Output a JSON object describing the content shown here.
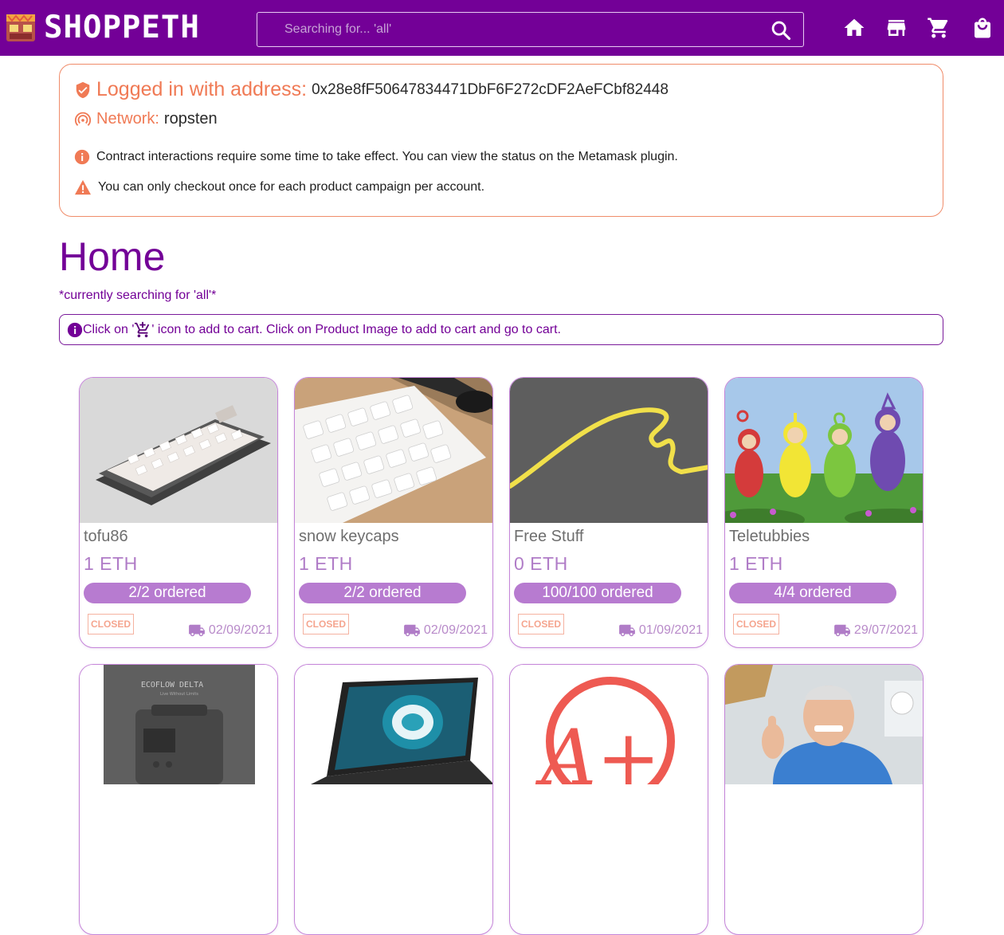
{
  "header": {
    "brand": "SHOPPETH",
    "search_placeholder": "Searching for... 'all'",
    "nav": [
      "home-icon",
      "store-icon",
      "cart-icon",
      "shopping-bag-icon"
    ]
  },
  "account": {
    "logged_label": "Logged in with address:",
    "address": "0x28e8fF50647834471DbF6F272cDF2AeFCbf82448",
    "network_label": "Network:",
    "network": "ropsten",
    "note_info": "Contract interactions require some time to take effect. You can view the status on the Metamask plugin.",
    "note_warning": "You can only checkout once for each product campaign per account."
  },
  "page": {
    "title": "Home",
    "search_note": "*currently searching for 'all'*",
    "hint_prefix": "Click on '",
    "hint_suffix": "' icon to add to cart. Click on Product Image to add to cart and go to cart."
  },
  "products": [
    {
      "name": "tofu86",
      "price": "1 ETH",
      "ordered": "2/2 ordered",
      "status": "CLOSED",
      "date": "02/09/2021",
      "image": "keyboard-photo"
    },
    {
      "name": "snow keycaps",
      "price": "1 ETH",
      "ordered": "2/2 ordered",
      "status": "CLOSED",
      "date": "02/09/2021",
      "image": "keycaps-photo"
    },
    {
      "name": "Free Stuff",
      "price": "0 ETH",
      "ordered": "100/100 ordered",
      "status": "CLOSED",
      "date": "01/09/2021",
      "image": "yellow-squiggle-image"
    },
    {
      "name": "Teletubbies",
      "price": "1 ETH",
      "ordered": "4/4 ordered",
      "status": "CLOSED",
      "date": "29/07/2021",
      "image": "teletubbies-photo"
    }
  ],
  "products_row2": [
    {
      "image": "ecoflow-delta-photo",
      "image_text": "ECOFLOW DELTA",
      "image_subtext": "Live Without Limits"
    },
    {
      "image": "laptop-photo"
    },
    {
      "image": "a-plus-image",
      "image_text": "A+"
    },
    {
      "image": "thumbs-up-man-photo"
    }
  ],
  "colors": {
    "brand": "#730097",
    "alert": "#f07a55",
    "card_border": "#c585d9",
    "progress": "#b77bd0"
  }
}
